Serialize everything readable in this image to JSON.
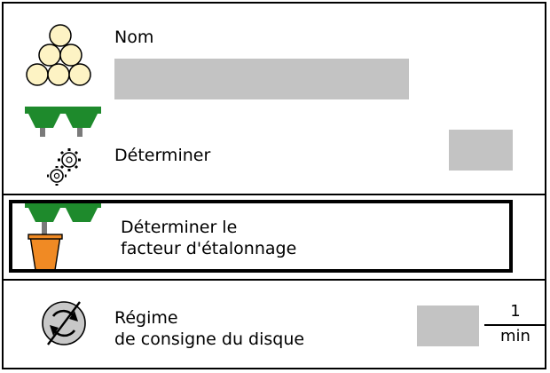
{
  "rows": [
    {
      "label": "Nom",
      "icon": "material-balls-icon"
    },
    {
      "label": "Déterminer",
      "icon": "hopper-gears-icon"
    },
    {
      "line1": "Déterminer le",
      "line2": "facteur d'étalonnage",
      "icon": "hopper-bucket-icon"
    },
    {
      "line1": "Régime",
      "line2": "de consigne du disque",
      "icon": "disc-speed-disabled-icon",
      "unit_numerator": "1",
      "unit_denominator": "min"
    }
  ],
  "colors": {
    "hopper_green": "#1e8a2c",
    "bucket_orange": "#f08a24",
    "field_gray": "#c3c3c3",
    "ball_fill": "#fdf3c4"
  }
}
